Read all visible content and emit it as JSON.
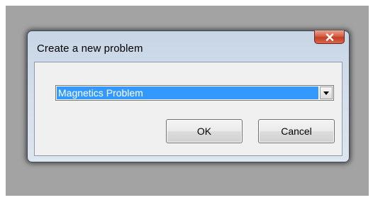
{
  "dialog": {
    "title": "Create a new problem",
    "close_icon": "close-x-icon",
    "problem_type": {
      "selected": "Magnetics Problem",
      "arrow_icon": "dropdown-arrow-icon"
    },
    "ok_label": "OK",
    "cancel_label": "Cancel"
  },
  "colors": {
    "selection": "#3399ff",
    "close_button": "#c94a30",
    "backdrop": "#a3a3a3"
  }
}
